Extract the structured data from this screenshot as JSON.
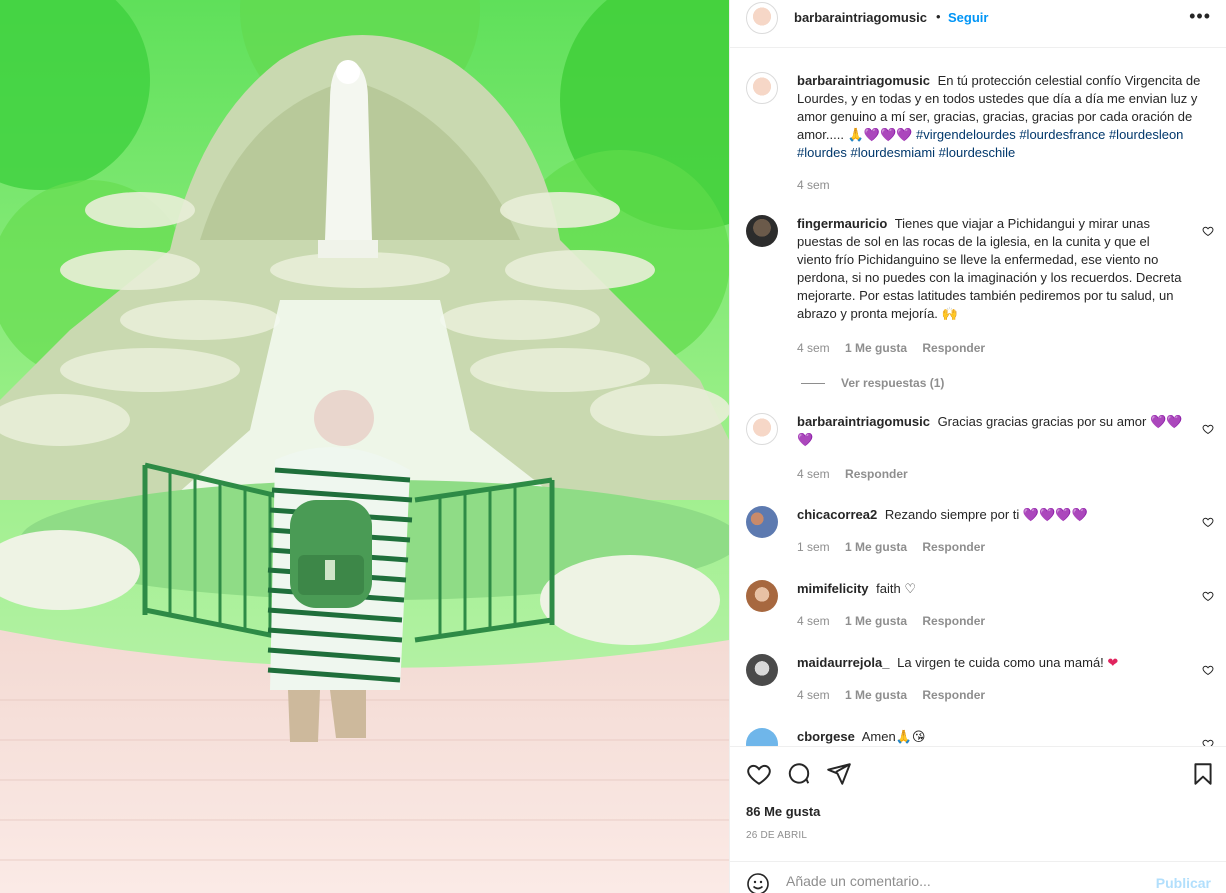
{
  "photo": {
    "alt_icon": "photo-virgen-lourdes"
  },
  "header": {
    "username": "barbaraintriagomusic",
    "separator": "•",
    "follow_label": "Seguir",
    "more_icon": "more-options-icon",
    "more_glyph": "•••"
  },
  "caption": {
    "username": "barbaraintriagomusic",
    "text": "En tú protección celestial confío Virgencita de Lourdes, y en todas y en todos ustedes que día a día me envian luz y amor genuino a mí ser, gracias, gracias, gracias por cada oración de amor.....",
    "emojis": "🙏💜💜💜",
    "hashtags": [
      "#virgendelourdes",
      "#lourdesfrance",
      "#lourdesleon",
      "#lourdes",
      "#lourdesmiami",
      "#lourdeschile"
    ],
    "time": "4 sem"
  },
  "comments": [
    {
      "username": "fingermauricio",
      "text": "Tienes que viajar a Pichidangui y mirar unas puestas de sol en las rocas de la iglesia, en la cunita y que el viento frío Pichidanguino se lleve la enfermedad, ese viento no perdona, si no puedes con la imaginación y los recuerdos. Decreta mejorarte. Por estas latitudes también pediremos por tu salud, un abrazo y pronta mejoría.",
      "emoji": "🙌",
      "time": "4 sem",
      "likes": "1 Me gusta",
      "reply": "Responder",
      "view_replies": "Ver respuestas (1)"
    },
    {
      "username": "barbaraintriagomusic",
      "text": "Gracias gracias gracias por su amor",
      "emoji": "💜💜💜",
      "time": "4 sem",
      "reply": "Responder"
    },
    {
      "username": "chicacorrea2",
      "text": "Rezando siempre por ti",
      "emoji": "💜💜💜💜",
      "time": "1 sem",
      "likes": "1 Me gusta",
      "reply": "Responder"
    },
    {
      "username": "mimifelicity",
      "text": "faith",
      "emoji": "♡",
      "time": "4 sem",
      "likes": "1 Me gusta",
      "reply": "Responder"
    },
    {
      "username": "maidaurrejola_",
      "text": "La virgen te cuida como una mamá!",
      "emoji": "❤",
      "time": "4 sem",
      "likes": "1 Me gusta",
      "reply": "Responder"
    },
    {
      "username": "cborgese",
      "text": "Amen",
      "emoji": "🙏😘"
    }
  ],
  "actions": {
    "like_icon": "heart-icon",
    "comment_icon": "comment-icon",
    "share_icon": "share-icon",
    "save_icon": "bookmark-icon"
  },
  "likes": "86 Me gusta",
  "date": "26 DE ABRIL",
  "add_comment": {
    "placeholder": "Añade un comentario...",
    "publish_label": "Publicar",
    "emoji_icon": "emoji-icon"
  },
  "colors": {
    "link_blue": "#0095f6",
    "hashtag_blue": "#00376b",
    "meta_gray": "#8e8e8e",
    "publish_disabled": "#b2dffc"
  }
}
